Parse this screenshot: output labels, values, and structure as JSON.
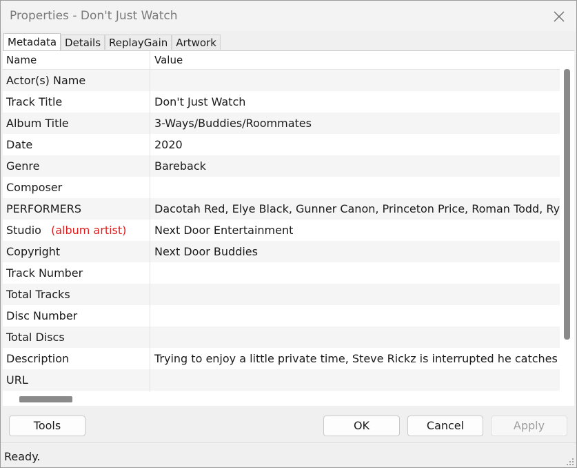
{
  "window": {
    "title": "Properties - Don't Just Watch"
  },
  "tabs": [
    {
      "label": "Metadata",
      "active": true
    },
    {
      "label": "Details",
      "active": false
    },
    {
      "label": "ReplayGain",
      "active": false
    },
    {
      "label": "Artwork",
      "active": false
    }
  ],
  "table": {
    "columns": [
      "Name",
      "Value"
    ],
    "rows": [
      {
        "name": "Actor(s) Name",
        "value": ""
      },
      {
        "name": "Track Title",
        "value": "Don't Just Watch"
      },
      {
        "name": "Album Title",
        "value": "3-Ways/Buddies/Roommates"
      },
      {
        "name": "Date",
        "value": "2020"
      },
      {
        "name": "Genre",
        "value": "Bareback"
      },
      {
        "name": "Composer",
        "value": ""
      },
      {
        "name": "PERFORMERS",
        "value": "Dacotah Red, Elye Black, Gunner Canon, Princeton Price, Roman Todd, Ryan"
      },
      {
        "name": "Studio",
        "value": "Next Door Entertainment",
        "annotation": "(album artist)"
      },
      {
        "name": "Copyright",
        "value": "Next Door Buddies"
      },
      {
        "name": "Track Number",
        "value": ""
      },
      {
        "name": "Total Tracks",
        "value": ""
      },
      {
        "name": "Disc Number",
        "value": ""
      },
      {
        "name": "Total Discs",
        "value": ""
      },
      {
        "name": "Description",
        "value": "Trying to enjoy a little private time, Steve Rickz is interrupted he catches roo"
      },
      {
        "name": "URL",
        "value": ""
      }
    ]
  },
  "buttons": {
    "tools": "Tools",
    "ok": "OK",
    "cancel": "Cancel",
    "apply": "Apply"
  },
  "status": {
    "text": "Ready."
  },
  "colors": {
    "annotation": "#e01b1b",
    "disabled_text": "#9d9d9d"
  },
  "icons": {
    "close": "close-icon",
    "grip": "resize-grip-icon"
  }
}
